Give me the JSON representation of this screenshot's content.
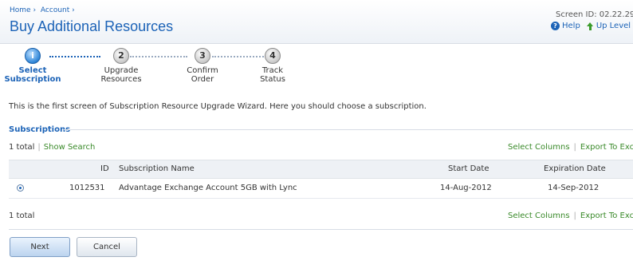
{
  "breadcrumb": [
    "Home ›",
    "Account ›"
  ],
  "title": "Buy Additional Resources",
  "screen_id": "Screen ID: 02.22.29",
  "help_label": "Help",
  "up_level_label": "Up Level",
  "wizard": {
    "steps": [
      {
        "number": "i",
        "label_line1": "Select",
        "label_line2": "Subscription",
        "active": true
      },
      {
        "number": "2",
        "label_line1": "Upgrade",
        "label_line2": "Resources",
        "active": false
      },
      {
        "number": "3",
        "label_line1": "Confirm",
        "label_line2": "Order",
        "active": false
      },
      {
        "number": "4",
        "label_line1": "Track",
        "label_line2": "Status",
        "active": false
      }
    ]
  },
  "intro": "This is the first screen of Subscription Resource Upgrade Wizard. Here you should choose a subscription.",
  "subscriptions": {
    "section_title": "Subscriptions",
    "total_label": "1 total",
    "show_search": "Show Search",
    "select_columns": "Select Columns",
    "export": "Export To Excel",
    "columns": {
      "id": "ID",
      "name": "Subscription Name",
      "start": "Start Date",
      "expiration": "Expiration Date"
    },
    "rows": [
      {
        "id": "1012531",
        "name": "Advantage Exchange Account 5GB with Lync",
        "start": "14-Aug-2012",
        "expiration": "14-Sep-2012",
        "selected": true
      }
    ],
    "bottom_total": "1 total"
  },
  "buttons": {
    "next": "Next",
    "cancel": "Cancel"
  },
  "colors": {
    "accent": "#1c63b7",
    "link_green": "#3a8a2a"
  }
}
